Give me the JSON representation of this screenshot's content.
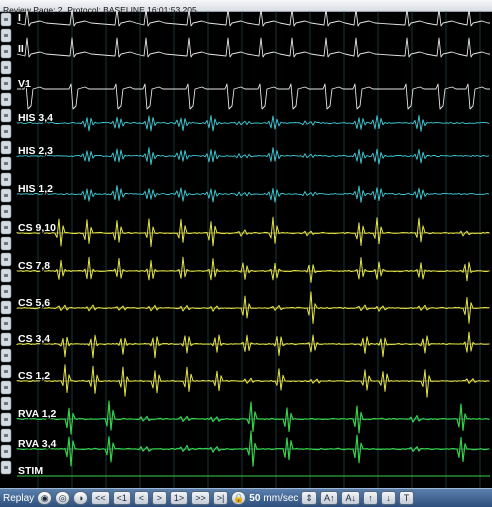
{
  "title": "Review Page: 2, Protocol: BASELINE    16:01:53.205",
  "channels": [
    {
      "label": "I",
      "color": "#e6e6e6",
      "kind": "ecg"
    },
    {
      "label": "II",
      "color": "#e6e6e6",
      "kind": "ecg"
    },
    {
      "label": "V1",
      "color": "#e6e6e6",
      "kind": "ecg"
    },
    {
      "label": "HIS 3,4",
      "color": "#3fd0dc",
      "kind": "his"
    },
    {
      "label": "HIS 2,3",
      "color": "#3fd0dc",
      "kind": "his"
    },
    {
      "label": "HIS 1,2",
      "color": "#3fd0dc",
      "kind": "his"
    },
    {
      "label": "CS 9,10",
      "color": "#e4e44a",
      "kind": "cs"
    },
    {
      "label": "CS 7,8",
      "color": "#e4e44a",
      "kind": "cs"
    },
    {
      "label": "CS 5,6",
      "color": "#e4e44a",
      "kind": "cs"
    },
    {
      "label": "CS 3,4",
      "color": "#e4e44a",
      "kind": "cs"
    },
    {
      "label": "CS 1,2",
      "color": "#e4e44a",
      "kind": "cs"
    },
    {
      "label": "RVA 1,2",
      "color": "#33d24a",
      "kind": "rva"
    },
    {
      "label": "RVA 3,4",
      "color": "#33d24a",
      "kind": "rva"
    },
    {
      "label": "STIM",
      "color": "#33d24a",
      "kind": "stim"
    }
  ],
  "toolbar": {
    "replay": "Replay",
    "icons": [
      "eye-icon",
      "lens-icon",
      "eye-alt-icon"
    ],
    "buttons": [
      "<<",
      "<1",
      "<",
      ">",
      "1>",
      ">>",
      ">|"
    ],
    "lock_icon": "lock-icon",
    "speed": "50",
    "speed_unit": "mm/sec",
    "right_buttons": [
      "A↑",
      "A↓",
      "↑",
      "↓",
      "T"
    ]
  },
  "colors": {
    "grid": "#2d6b6b",
    "background": "#000000",
    "toolbar": "#3e6394"
  }
}
